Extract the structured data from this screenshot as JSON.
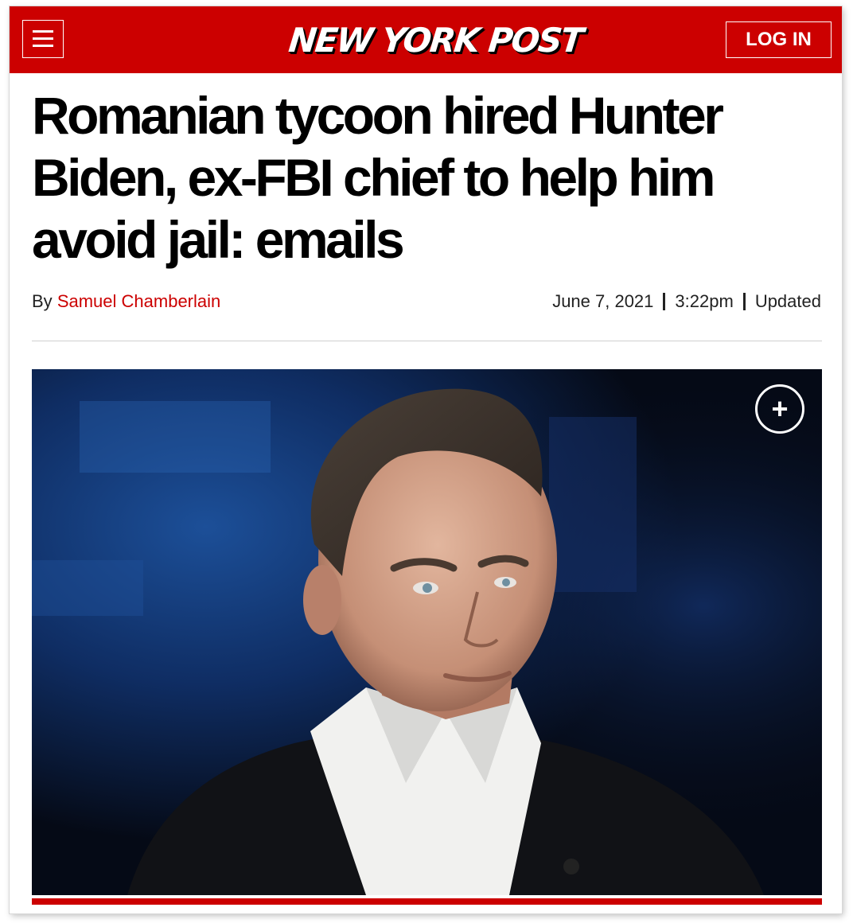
{
  "header": {
    "logo_text": "NEW YORK POST",
    "login_label": "LOG IN",
    "brand_color": "#cc0000",
    "menu_icon": "hamburger-menu-icon"
  },
  "article": {
    "headline": "Romanian tycoon hired Hunter Biden, ex-FBI chief to help him avoid jail: emails",
    "by_label": "By",
    "author": "Samuel Chamberlain",
    "date": "June 7, 2021",
    "time": "3:22pm",
    "updated_label": "Updated"
  },
  "photo": {
    "expand_icon": "plus-circle-icon",
    "expand_glyph": "+"
  }
}
